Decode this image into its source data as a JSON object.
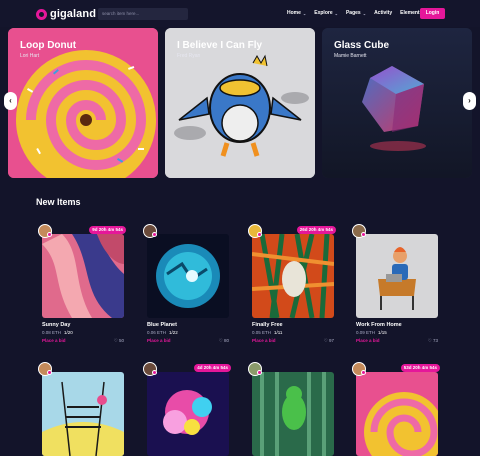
{
  "header": {
    "logo_text": "gigaland",
    "search_placeholder": "search item here...",
    "nav": [
      {
        "label": "Home",
        "chevron": true
      },
      {
        "label": "Explore",
        "chevron": true
      },
      {
        "label": "Pages",
        "chevron": true
      },
      {
        "label": "Activity",
        "chevron": false
      },
      {
        "label": "Elements",
        "chevron": true
      }
    ],
    "login_label": "Login"
  },
  "carousel": {
    "slides": [
      {
        "title": "Loop Donut",
        "author": "Lori Hart"
      },
      {
        "title": "I Believe I Can Fly",
        "author": "Fred Ryan"
      },
      {
        "title": "Glass Cube",
        "author": "Mamie Barnett"
      }
    ],
    "prev_icon": "‹",
    "next_icon": "›"
  },
  "new_items": {
    "title": "New Items",
    "items": [
      {
        "timer": "9d 20h 4m 54s",
        "name": "Sunny Day",
        "price": "0.08 ETH",
        "edition": "1/20",
        "bid": "Place a bid",
        "likes": "50"
      },
      {
        "timer": "",
        "name": "Blue Planet",
        "price": "0.06 ETH",
        "edition": "1/22",
        "bid": "Place a bid",
        "likes": "80"
      },
      {
        "timer": "26d 20h 4m 54s",
        "name": "Finally Free",
        "price": "0.05 ETH",
        "edition": "1/11",
        "bid": "Place a bid",
        "likes": "97"
      },
      {
        "timer": "",
        "name": "Work From Home",
        "price": "0.09 ETH",
        "edition": "1/15",
        "bid": "Place a bid",
        "likes": "73"
      },
      {
        "timer": ""
      },
      {
        "timer": "4d 20h 4m 54s"
      },
      {
        "timer": ""
      },
      {
        "timer": "53d 20h 4m 54s"
      }
    ]
  },
  "colors": {
    "accent": "#e5179a",
    "bg": "#13142a"
  }
}
